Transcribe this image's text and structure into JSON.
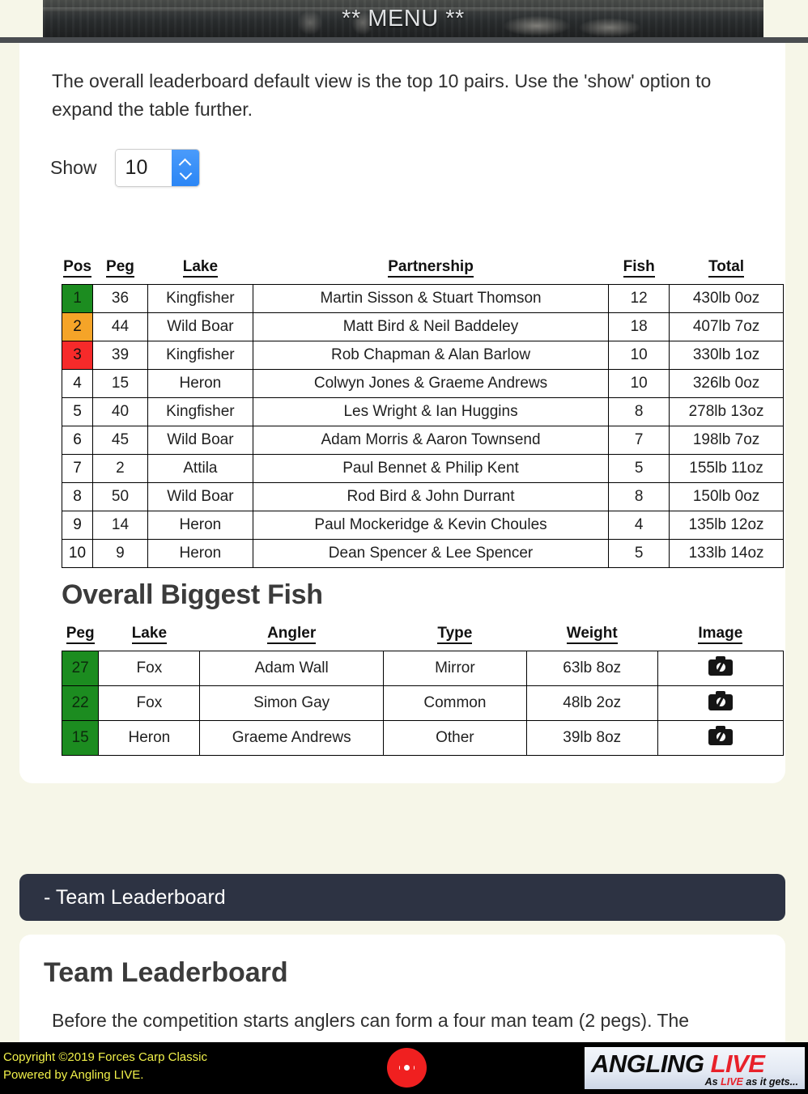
{
  "menu": {
    "title": "** MENU **"
  },
  "overall": {
    "intro": "The overall leaderboard default view is the top 10 pairs. Use the 'show' option to expand the table further.",
    "show_label": "Show",
    "show_value": "10",
    "columns": [
      "Pos",
      "Peg",
      "Lake",
      "Partnership",
      "Fish",
      "Total"
    ],
    "rows": [
      {
        "pos": "1",
        "peg": "36",
        "lake": "Kingfisher",
        "partnership": "Martin Sisson & Stuart Thomson",
        "fish": "12",
        "total": "430lb 0oz",
        "rank_color": "#1c8c20"
      },
      {
        "pos": "2",
        "peg": "44",
        "lake": "Wild Boar",
        "partnership": "Matt Bird & Neil Baddeley",
        "fish": "18",
        "total": "407lb 7oz",
        "rank_color": "#f5a428"
      },
      {
        "pos": "3",
        "peg": "39",
        "lake": "Kingfisher",
        "partnership": "Rob Chapman & Alan Barlow",
        "fish": "10",
        "total": "330lb 1oz",
        "rank_color": "#f62a2a"
      },
      {
        "pos": "4",
        "peg": "15",
        "lake": "Heron",
        "partnership": "Colwyn Jones & Graeme Andrews",
        "fish": "10",
        "total": "326lb 0oz",
        "rank_color": ""
      },
      {
        "pos": "5",
        "peg": "40",
        "lake": "Kingfisher",
        "partnership": "Les Wright & Ian Huggins",
        "fish": "8",
        "total": "278lb 13oz",
        "rank_color": ""
      },
      {
        "pos": "6",
        "peg": "45",
        "lake": "Wild Boar",
        "partnership": "Adam Morris & Aaron Townsend",
        "fish": "7",
        "total": "198lb 7oz",
        "rank_color": ""
      },
      {
        "pos": "7",
        "peg": "2",
        "lake": "Attila",
        "partnership": "Paul Bennet & Philip Kent",
        "fish": "5",
        "total": "155lb 11oz",
        "rank_color": ""
      },
      {
        "pos": "8",
        "peg": "50",
        "lake": "Wild Boar",
        "partnership": "Rod Bird & John Durrant",
        "fish": "8",
        "total": "150lb 0oz",
        "rank_color": ""
      },
      {
        "pos": "9",
        "peg": "14",
        "lake": "Heron",
        "partnership": "Paul Mockeridge & Kevin Choules",
        "fish": "4",
        "total": "135lb 12oz",
        "rank_color": ""
      },
      {
        "pos": "10",
        "peg": "9",
        "lake": "Heron",
        "partnership": "Dean Spencer & Lee Spencer",
        "fish": "5",
        "total": "133lb 14oz",
        "rank_color": ""
      }
    ]
  },
  "biggest_fish": {
    "title": "Overall Biggest Fish",
    "columns": [
      "Peg",
      "Lake",
      "Angler",
      "Type",
      "Weight",
      "Image"
    ],
    "rows": [
      {
        "peg": "27",
        "lake": "Fox",
        "angler": "Adam Wall",
        "type": "Mirror",
        "weight": "63lb 8oz",
        "image_icon": "camera-icon"
      },
      {
        "peg": "22",
        "lake": "Fox",
        "angler": "Simon Gay",
        "type": "Common",
        "weight": "48lb 2oz",
        "image_icon": "camera-icon"
      },
      {
        "peg": "15",
        "lake": "Heron",
        "angler": "Graeme Andrews",
        "type": "Other",
        "weight": "39lb 8oz",
        "image_icon": "camera-icon"
      }
    ]
  },
  "team_section": {
    "accordion_label": "- Team Leaderboard",
    "heading": "Team Leaderboard",
    "text": "Before the competition starts anglers can form a four man team (2 pegs). The"
  },
  "footer": {
    "copyright_line1": "Copyright ©2019 Forces Carp Classic",
    "copyright_line2": "Powered by Angling LIVE.",
    "live_icon": "live-record-icon",
    "logo_main": "ANGLING",
    "logo_live": "LIVE",
    "logo_tagline_pre": "As ",
    "logo_tagline_red": "LIVE",
    "logo_tagline_post": " as it gets..."
  },
  "colors": {
    "page_background": "#f6f6e8",
    "rank_first": "#1c8c20",
    "rank_second": "#f5a428",
    "rank_third": "#f62a2a",
    "peg_green": "#1c8c20",
    "accordion": "#2d3343",
    "footer_bg": "#000000",
    "footer_text": "#f2f24a",
    "accent_blue": "#2b86f5",
    "logo_red": "#e8212a"
  }
}
